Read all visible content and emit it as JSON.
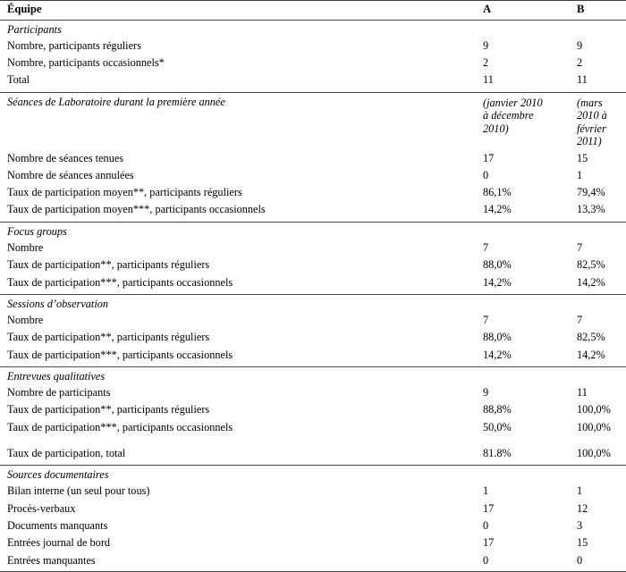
{
  "table": {
    "header": {
      "label": "Équipe",
      "col_a": "A",
      "col_b": "B"
    },
    "sections": [
      {
        "title": "Participants",
        "title_a": "",
        "title_b": "",
        "rows": [
          {
            "label": "Nombre, participants réguliers",
            "indent": 1,
            "a": "9",
            "b": "9"
          },
          {
            "label": "Nombre, participants occasionnels*",
            "indent": 1,
            "a": "2",
            "b": "2"
          },
          {
            "label": "Total",
            "indent": 2,
            "a": "11",
            "b": "11"
          }
        ]
      },
      {
        "title": "Séances de Laboratoire durant la première année",
        "title_a": "(janvier 2010 à décembre 2010)",
        "title_b": "(mars 2010 à février 2011)",
        "rows": [
          {
            "label": "Nombre de séances tenues",
            "indent": 1,
            "a": "17",
            "b": "15"
          },
          {
            "label": "Nombre de séances annulées",
            "indent": 1,
            "a": "0",
            "b": "1"
          },
          {
            "label": "Taux de participation moyen**, participants réguliers",
            "indent": 1,
            "a": "86,1%",
            "b": "79,4%"
          },
          {
            "label": "Taux de participation moyen***, participants occasionnels",
            "indent": 1,
            "a": "14,2%",
            "b": "13,3%"
          }
        ]
      },
      {
        "title": "Focus groups",
        "title_a": "",
        "title_b": "",
        "rows": [
          {
            "label": "Nombre",
            "indent": 1,
            "a": "7",
            "b": "7"
          },
          {
            "label": "Taux de participation**, participants réguliers",
            "indent": 1,
            "a": "88,0%",
            "b": "82,5%"
          },
          {
            "label": "Taux de participation***, participants occasionnels",
            "indent": 1,
            "a": "14,2%",
            "b": "14,2%"
          }
        ]
      },
      {
        "title": "Sessions d’observation",
        "title_a": "",
        "title_b": "",
        "rows": [
          {
            "label": "Nombre",
            "indent": 1,
            "a": "7",
            "b": "7"
          },
          {
            "label": "Taux de participation**, participants réguliers",
            "indent": 1,
            "a": "88,0%",
            "b": "82,5%"
          },
          {
            "label": "Taux de participation***, participants occasionnels",
            "indent": 1,
            "a": "14,2%",
            "b": "14,2%"
          }
        ]
      },
      {
        "title": "Entrevues qualitatives",
        "title_a": "",
        "title_b": "",
        "rows": [
          {
            "label": "Nombre de participants",
            "indent": 1,
            "a": "9",
            "b": "11"
          },
          {
            "label": "Taux de participation**, participants réguliers",
            "indent": 1,
            "a": "88,8%",
            "b": "100,0%"
          },
          {
            "label": "Taux de participation***, participants occasionnels",
            "indent": 1,
            "a": "50,0%",
            "b": "100,0%"
          },
          {
            "label": "Taux de participation, total",
            "indent": 1,
            "a": "81.8%",
            "b": "100,0%",
            "spaced": true
          }
        ]
      },
      {
        "title": "Sources documentaires",
        "title_a": "",
        "title_b": "",
        "rows": [
          {
            "label": "Bilan interne (un seul pour tous)",
            "indent": 1,
            "a": "1",
            "b": "1"
          },
          {
            "label": "Procès-verbaux",
            "indent": 1,
            "a": "17",
            "b": "12"
          },
          {
            "label": "Documents manquants",
            "indent": 2,
            "a": "0",
            "b": "3"
          },
          {
            "label": "Entrées journal de bord",
            "indent": 1,
            "a": "17",
            "b": "15"
          },
          {
            "label": "Entrées manquantes",
            "indent": 2,
            "a": "0",
            "b": "0"
          }
        ]
      }
    ]
  }
}
